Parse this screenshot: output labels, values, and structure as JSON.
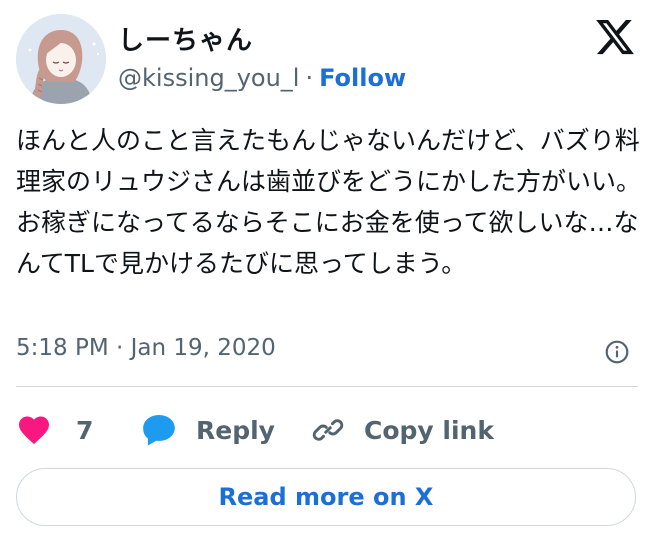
{
  "author": {
    "display_name": "しーちゃん",
    "handle": "@kissing_you_l",
    "separator": "·",
    "follow_label": "Follow",
    "avatar_icon": "avatar-illustration-icon"
  },
  "brand": {
    "logo_icon": "x-logo-icon",
    "color": "#0f1419"
  },
  "tweet": {
    "text": "ほんと人のこと言えたもんじゃないんだけど、バズり料理家のリュウジさんは歯並びをどうにかした方がいい。\nお稼ぎになってるならそこにお金を使って欲しいな…なんてTLで見かけるたびに思ってしまう。",
    "timestamp": "5:18 PM · Jan 19, 2020",
    "info_icon": "info-icon"
  },
  "actions": {
    "like": {
      "count": "7",
      "icon": "heart-icon",
      "color": "#f91880"
    },
    "reply": {
      "label": "Reply",
      "icon": "speech-bubble-icon",
      "color": "#1d9bf0"
    },
    "copy": {
      "label": "Copy link",
      "icon": "link-icon"
    }
  },
  "footer": {
    "read_more_label": "Read more on X"
  },
  "colors": {
    "accent": "#1d6fd8",
    "muted": "#536471",
    "border": "#cfd9de"
  }
}
